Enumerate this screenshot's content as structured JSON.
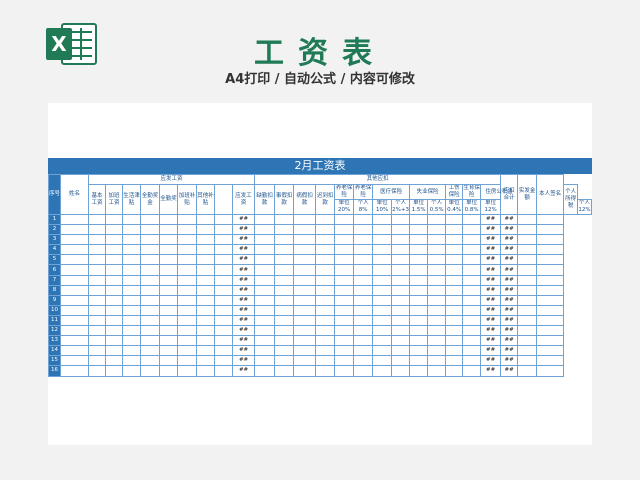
{
  "page": {
    "title": "工资表",
    "subtitle": "A4打印 / 自动公式 / 内容可修改",
    "icon": "excel-icon",
    "accent_color": "#1f7a55",
    "banner_color": "#2e75b6"
  },
  "sheet": {
    "banner_title": "2月工资表",
    "headers": {
      "seq": "序号",
      "name": "姓名",
      "should_pay_group": "应发工资",
      "other_deduct_group": "其他应扣",
      "base_wage": "基本工资",
      "overtime_wage": "加班工资",
      "living_allowance": "生活津贴",
      "attendance_bonus": "全勤奖金",
      "full_bonus": "全勤奖",
      "overtime_subsidy": "加班补贴",
      "other_subsidy": "其他补贴",
      "should_pay": "应发工资",
      "absence_deduct": "缺勤扣款",
      "leave_deduct": "事假扣款",
      "sick_deduct": "病假扣款",
      "late_deduct": "迟到扣款",
      "pension_unit": "养老保险",
      "pension_personal": "养老保险",
      "medical": "医疗保险",
      "unemployment": "失业保险",
      "injury": "工伤保险",
      "maternity": "生育保险",
      "housing_fund": "住房公积金",
      "personal_tax": "个人所得税",
      "should_deduct": "应扣合计",
      "actual_pay": "实发金额",
      "signature": "本人签名",
      "unit": "单位",
      "personal": "个人",
      "r_pension_unit": "20%",
      "r_pension_personal": "8%",
      "r_medical_unit": "10%",
      "r_medical_personal": "2%+3",
      "r_unemp_unit": "1.5%",
      "r_unemp_personal": "0.5%",
      "r_injury": "0.4%",
      "r_maternity": "0.8%",
      "r_housing_unit": "12%",
      "r_housing_personal": "12%"
    },
    "hash": "##",
    "rows": [
      "1",
      "2",
      "3",
      "4",
      "5",
      "6",
      "7",
      "8",
      "9",
      "10",
      "11",
      "12",
      "13",
      "14",
      "15",
      "16"
    ]
  }
}
